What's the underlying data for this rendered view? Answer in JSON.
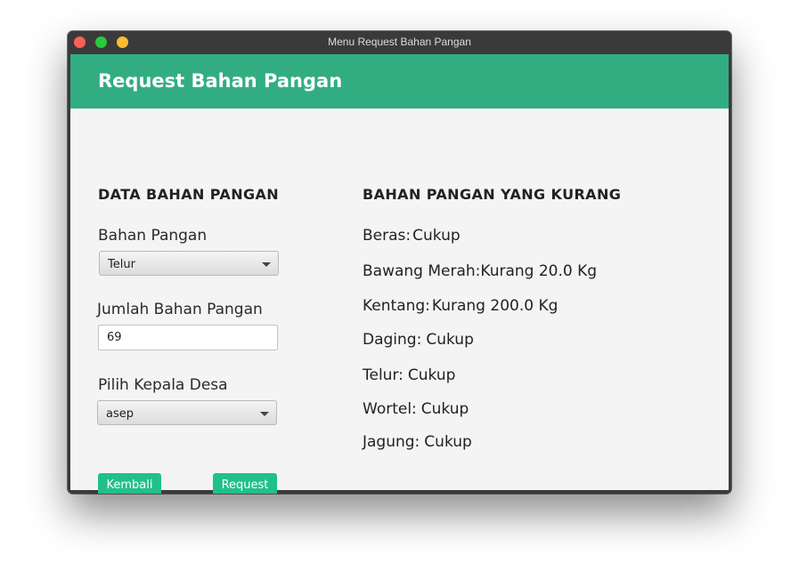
{
  "window": {
    "title": "Menu Request Bahan Pangan"
  },
  "header": {
    "title": "Request Bahan Pangan"
  },
  "left": {
    "section_title": "DATA BAHAN PANGAN",
    "bahan_label": "Bahan Pangan",
    "bahan_selected": "Telur",
    "jumlah_label": "Jumlah Bahan Pangan",
    "jumlah_value": "69",
    "kepala_label": "Pilih Kepala Desa",
    "kepala_selected": "asep",
    "back_label": "Kembali",
    "request_label": "Request"
  },
  "right": {
    "section_title": "BAHAN PANGAN YANG KURANG",
    "items": [
      {
        "name": "Beras:",
        "status": "Cukup"
      },
      {
        "name": "Bawang Merah:",
        "status": "Kurang 20.0 Kg"
      },
      {
        "name": "Kentang:",
        "status": "Kurang 200.0 Kg"
      },
      {
        "name": "Daging:",
        "status": "Cukup"
      },
      {
        "name": "Telur:",
        "status": "Cukup"
      },
      {
        "name": "Wortel:",
        "status": "Cukup"
      },
      {
        "name": "Jagung:",
        "status": "Cukup"
      }
    ]
  },
  "colors": {
    "header": "#32ad82",
    "button": "#21c08a"
  }
}
